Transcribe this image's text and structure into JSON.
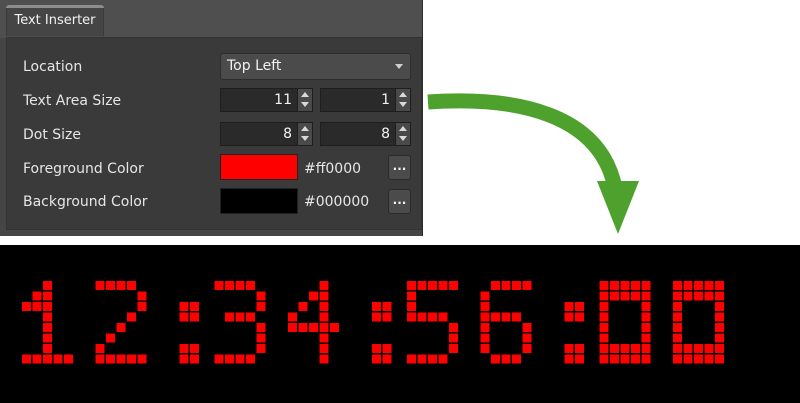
{
  "panel": {
    "tab_label": "Text Inserter",
    "location": {
      "label": "Location",
      "value": "Top Left"
    },
    "text_area_size": {
      "label": "Text Area Size",
      "width": "11",
      "height": "1"
    },
    "dot_size": {
      "label": "Dot Size",
      "width": "8",
      "height": "8"
    },
    "foreground": {
      "label": "Foreground Color",
      "hex": "#ff0000",
      "button": "..."
    },
    "background": {
      "label": "Background Color",
      "hex": "#000000",
      "button": "..."
    }
  },
  "display": {
    "text": "12:34:56:00",
    "foreground_color": "#ff0000",
    "background_color": "#000000"
  },
  "arrow": {
    "color": "#4fa12e",
    "icon": "curved-arrow-down-icon"
  }
}
